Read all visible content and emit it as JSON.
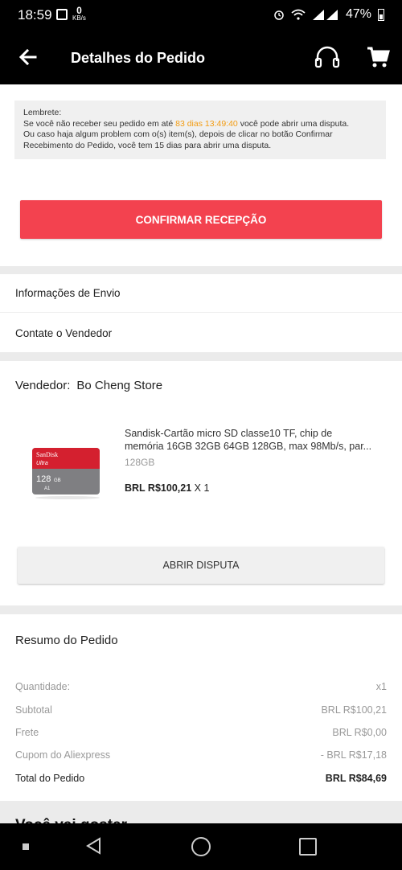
{
  "status_bar": {
    "time": "18:59",
    "net_speed_value": "0",
    "net_speed_unit": "KB/s",
    "battery": "47%"
  },
  "app_bar": {
    "title": "Detalhes do Pedido"
  },
  "reminder": {
    "heading": "Lembrete:",
    "line1_prefix": "Se você não receber seu pedido em até ",
    "countdown": "83 dias 13:49:40",
    "line1_suffix": " você pode abrir uma disputa.",
    "line2": "Ou caso haja algum problem com o(s) item(s), depois de clicar no botão Confirmar Recebimento do Pedido, você tem 15 dias para abrir uma disputa."
  },
  "confirm_button": "CONFIRMAR RECEPÇÃO",
  "links": {
    "shipping_info": "Informações de Envio",
    "contact_seller": "Contate o Vendedor"
  },
  "seller": {
    "label": "Vendedor:",
    "name": "Bo Cheng  Store"
  },
  "product": {
    "title_line1": "Sandisk-Cartão micro SD classe10 TF, chip de",
    "title_line2": "memória 16GB 32GB 64GB 128GB, max 98Mb/s, par...",
    "variant": "128GB",
    "price": "BRL R$100,21",
    "quantity": "X 1",
    "image_labels": {
      "brand": "SanDisk",
      "line": "Ultra",
      "capacity": "128",
      "unit": "GB",
      "class": "A1"
    }
  },
  "dispute_button": "ABRIR DISPUTA",
  "summary": {
    "title": "Resumo do Pedido",
    "rows": [
      {
        "label": "Quantidade:",
        "value": "x1"
      },
      {
        "label": "Subtotal",
        "value": "BRL R$100,21"
      },
      {
        "label": "Frete",
        "value": "BRL R$0,00"
      },
      {
        "label": "Cupom do Aliexpress",
        "value": "- BRL R$17,18"
      },
      {
        "label": "Total do Pedido",
        "value": "BRL R$84,69"
      }
    ]
  },
  "next_section_peek": "Você vai gostar",
  "colors": {
    "accent": "#f3424f",
    "countdown": "#f39c12"
  }
}
